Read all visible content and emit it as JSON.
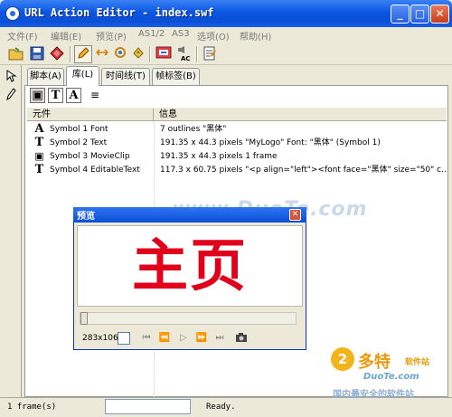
{
  "window": {
    "title": "URL Action Editor - index.swf",
    "controls": [
      "_",
      "□",
      "✕"
    ]
  },
  "menu": [
    "文件(F)",
    "编辑(E)",
    "预览(P)",
    "AS1/2",
    "AS3",
    "选项(O)",
    "帮助(H)"
  ],
  "toolbar": {
    "icons": [
      "open-folder",
      "save",
      "script-gem",
      "action-pencil",
      "arrows",
      "swap",
      "puzzle",
      "gallery-card",
      "ac-sound",
      "notes"
    ],
    "ac_label": "AC"
  },
  "tabs": [
    "脚本(A)",
    "库(L)",
    "时间线(T)",
    "帧标签(B)"
  ],
  "active_tab": 1,
  "panel_tools": [
    "▣",
    "T",
    "A",
    "≡"
  ],
  "library": {
    "columns": [
      "元件",
      "信息"
    ],
    "rows": [
      {
        "icon": "A",
        "name": "Symbol 1 Font",
        "info": "7 outlines \"黑体\""
      },
      {
        "icon": "T",
        "name": "Symbol 2 Text",
        "info": "191.35 x 44.3 pixels  \"MyLogo\" Font: \"黑体\" (Symbol 1)"
      },
      {
        "icon": "▣",
        "name": "Symbol 3 MovieClip",
        "info": "191.35 x 44.3 pixels  1 frame"
      },
      {
        "icon": "T",
        "name": "Symbol 4 EditableText",
        "info": "117.3 x 60.75 pixels  \"<p align=\"left\"><font face=\"黑体\" size=\"50\" c..."
      }
    ]
  },
  "preview": {
    "title": "预览",
    "stage_text": "主页",
    "dimensions": "283x106",
    "accent": "#e0001b",
    "slider_value": 0
  },
  "status": {
    "frames": "1 frame(s)",
    "ready": "Ready."
  },
  "watermarks": {
    "center": "www.DuoTe.com",
    "badge": "2",
    "brand": "多特",
    "brand_sub": "软件站",
    "url": "DuoTe.com",
    "tagline": "国内最安全的软件站"
  }
}
